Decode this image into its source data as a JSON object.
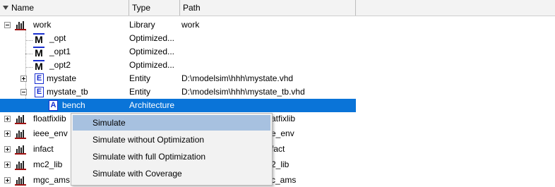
{
  "header": {
    "name_label": "Name",
    "type_label": "Type",
    "path_label": "Path"
  },
  "rows": [
    {
      "name": "work",
      "type": "Library",
      "path": "work"
    },
    {
      "name": "_opt",
      "type": "Optimized...",
      "path": ""
    },
    {
      "name": "_opt1",
      "type": "Optimized...",
      "path": ""
    },
    {
      "name": "_opt2",
      "type": "Optimized...",
      "path": ""
    },
    {
      "name": "mystate",
      "type": "Entity",
      "path": "D:\\modelsim\\hhh\\mystate.vhd"
    },
    {
      "name": "mystate_tb",
      "type": "Entity",
      "path": "D:\\modelsim\\hhh\\mystate_tb.vhd"
    },
    {
      "name": "bench",
      "type": "Architecture",
      "path": ""
    },
    {
      "name": "floatfixlib",
      "type": "",
      "path": "atfixlib"
    },
    {
      "name": "ieee_env",
      "type": "",
      "path": "e_env"
    },
    {
      "name": "infact",
      "type": "",
      "path": "fact"
    },
    {
      "name": "mc2_lib",
      "type": "",
      "path": "2_lib"
    },
    {
      "name": "mgc_ams",
      "type": "",
      "path": "c_ams"
    }
  ],
  "icons": {
    "library": "library-icon",
    "module": "module-icon",
    "entity": "entity-icon",
    "architecture": "architecture-icon"
  },
  "context_menu": {
    "items": [
      "Simulate",
      "Simulate without Optimization",
      "Simulate with full Optimization",
      "Simulate with Coverage"
    ]
  },
  "colors": {
    "selection": "#0a74d8",
    "menu_hover": "#a7c1e0",
    "library_bar": "#a01010",
    "design_unit_blue": "#1a2fd0"
  }
}
